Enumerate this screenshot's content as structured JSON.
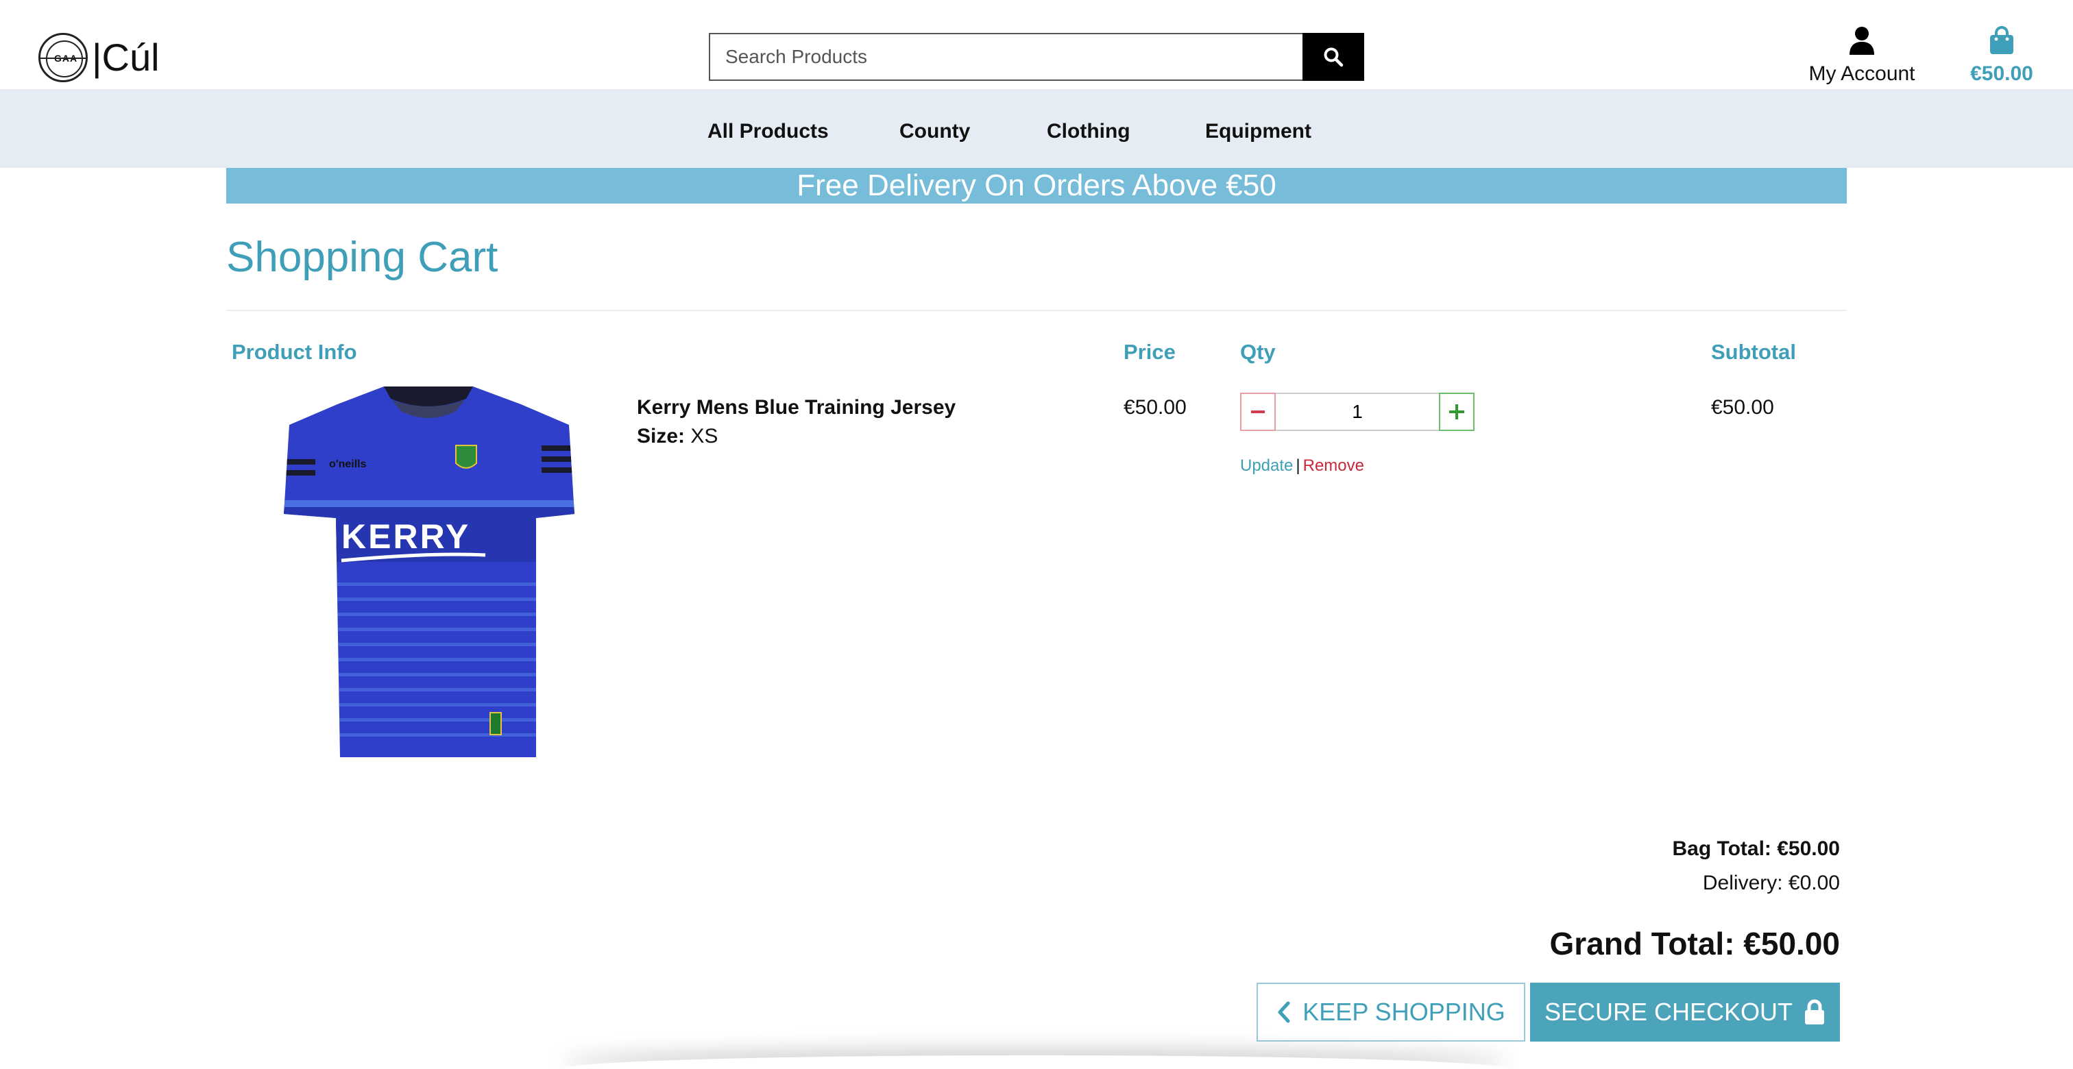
{
  "header": {
    "logo_text": "|Cúl",
    "logo_badge_text": "GAA",
    "search_placeholder": "Search Products",
    "account_label": "My Account",
    "cart_total": "€50.00"
  },
  "nav": {
    "items": [
      {
        "label": "All Products"
      },
      {
        "label": "County"
      },
      {
        "label": "Clothing"
      },
      {
        "label": "Equipment"
      }
    ]
  },
  "banner": {
    "text": "Free Delivery On Orders Above €50"
  },
  "cart": {
    "title": "Shopping Cart",
    "columns": {
      "product_info": "Product Info",
      "price": "Price",
      "qty": "Qty",
      "subtotal": "Subtotal"
    },
    "items": [
      {
        "name": "Kerry Mens Blue Training Jersey",
        "size_label": "Size:",
        "size_value": " XS",
        "price": "€50.00",
        "qty": "1",
        "update_label": "Update",
        "separator": "|",
        "remove_label": "Remove",
        "subtotal": "€50.00",
        "jersey_text": "KERRY",
        "brand_text": "o'neills"
      }
    ]
  },
  "totals": {
    "bag_total": "Bag Total: €50.00",
    "delivery": "Delivery: €0.00",
    "grand_total": "Grand Total: €50.00"
  },
  "buttons": {
    "keep_shopping": "KEEP SHOPPING",
    "secure_checkout": "SECURE CHECKOUT"
  },
  "colors": {
    "accent": "#3f9fb8",
    "banner": "#77bcd9",
    "nav_bg": "#e5ecf4",
    "remove": "#c9283a",
    "jersey": "#2b3fc4"
  }
}
